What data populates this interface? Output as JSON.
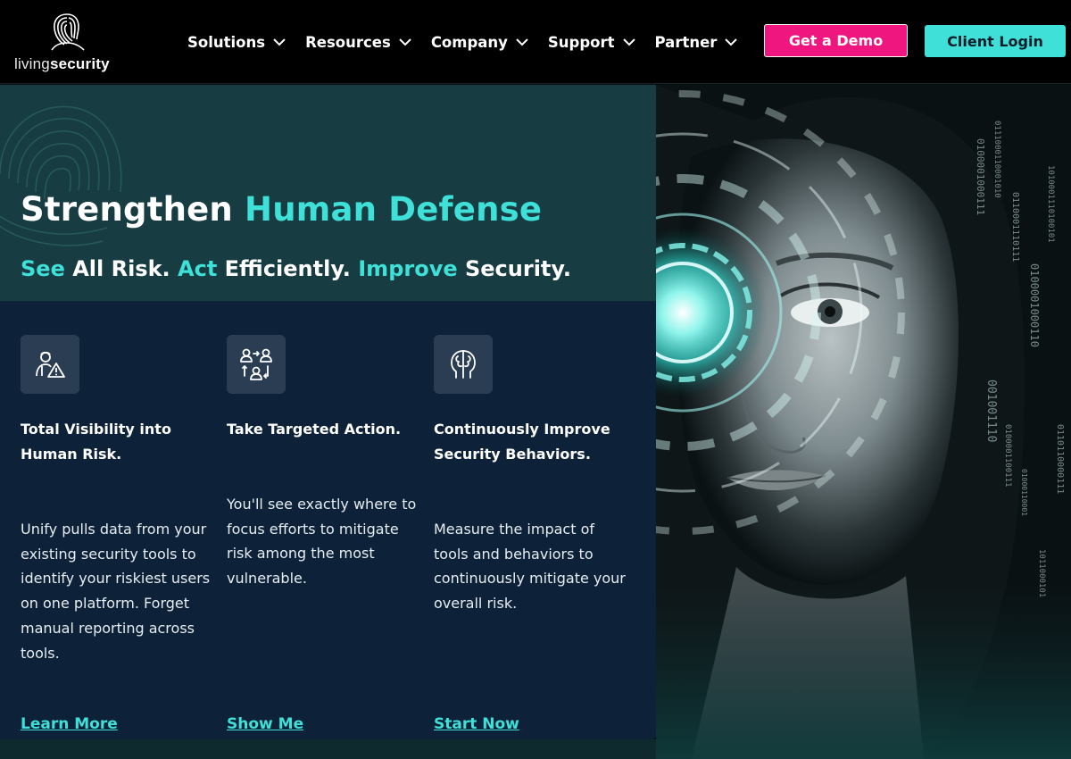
{
  "brand": {
    "logo_light": "living",
    "logo_bold": "security"
  },
  "nav": {
    "items": [
      {
        "label": "Solutions"
      },
      {
        "label": "Resources"
      },
      {
        "label": "Company"
      },
      {
        "label": "Support"
      },
      {
        "label": "Partner"
      }
    ],
    "demo_button": "Get a Demo",
    "login_button": "Client Login"
  },
  "hero": {
    "title_plain": "Strengthen ",
    "title_accent": "Human Defense",
    "sub": {
      "part1_accent": "See",
      "part1_text": " All Risk. ",
      "part2_accent": "Act",
      "part2_text": " Efficiently. ",
      "part3_accent": "Improve",
      "part3_text": " Security."
    }
  },
  "features": [
    {
      "icon": "user-warning-icon",
      "title": "Total Visibility into Human Risk.",
      "description": "Unify pulls data from your existing security tools to identify your riskiest users on one platform. Forget manual reporting across tools.",
      "link": "Learn More"
    },
    {
      "icon": "users-exchange-icon",
      "title": "Take Targeted Action.",
      "description": "You'll see exactly where to focus efforts to mitigate risk among the most vulnerable.",
      "link": "Show Me"
    },
    {
      "icon": "brain-profile-icon",
      "title": "Continuously Improve Security Behaviors.",
      "description": "Measure the impact of tools and behaviors to continuously mitigate your overall risk.",
      "link": "Start Now"
    }
  ],
  "colors": {
    "accent": "#3ee0d8",
    "demo": "#f0167f",
    "card_top": "#173d42",
    "card_bottom": "#0d2238"
  }
}
